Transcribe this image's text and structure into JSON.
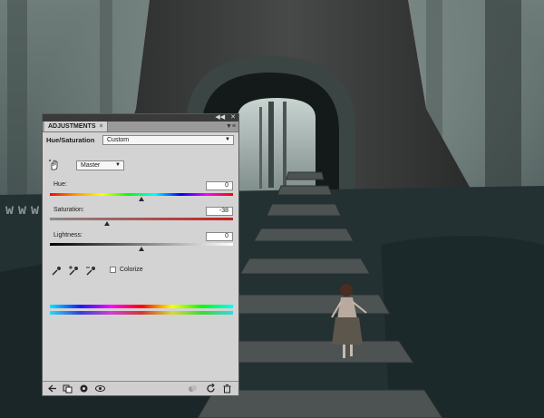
{
  "panel": {
    "tab_label": "ADJUSTMENTS",
    "title": "Hue/Saturation",
    "preset": "Custom",
    "channel": "Master",
    "hue": {
      "label": "Hue:",
      "value": "0",
      "position": 0.5
    },
    "saturation": {
      "label": "Saturation:",
      "value": "-38",
      "position": 0.31
    },
    "lightness": {
      "label": "Lightness:",
      "value": "0",
      "position": 0.5
    },
    "colorize_label": "Colorize",
    "colorize_checked": false
  },
  "watermark": "www.idianshejj.com",
  "icons": {
    "top": [
      "collapse-icon",
      "close-icon",
      "panel-menu-icon"
    ],
    "tools": [
      "hand-adjust-icon",
      "eyedropper-icon",
      "eyedropper-plus-icon",
      "eyedropper-minus-icon"
    ],
    "bottom_left": [
      "back-icon",
      "clip-layer-icon",
      "visibility-toggle-icon",
      "view-previous-icon"
    ],
    "bottom_right": [
      "reset-icon",
      "refresh-icon",
      "delete-icon"
    ]
  },
  "colors": {
    "panel_bg": "#d3d3d3",
    "panel_header": "#3a3a3a",
    "tab_bar": "#9a9a9a",
    "saturation_track": "#c71f1f"
  }
}
